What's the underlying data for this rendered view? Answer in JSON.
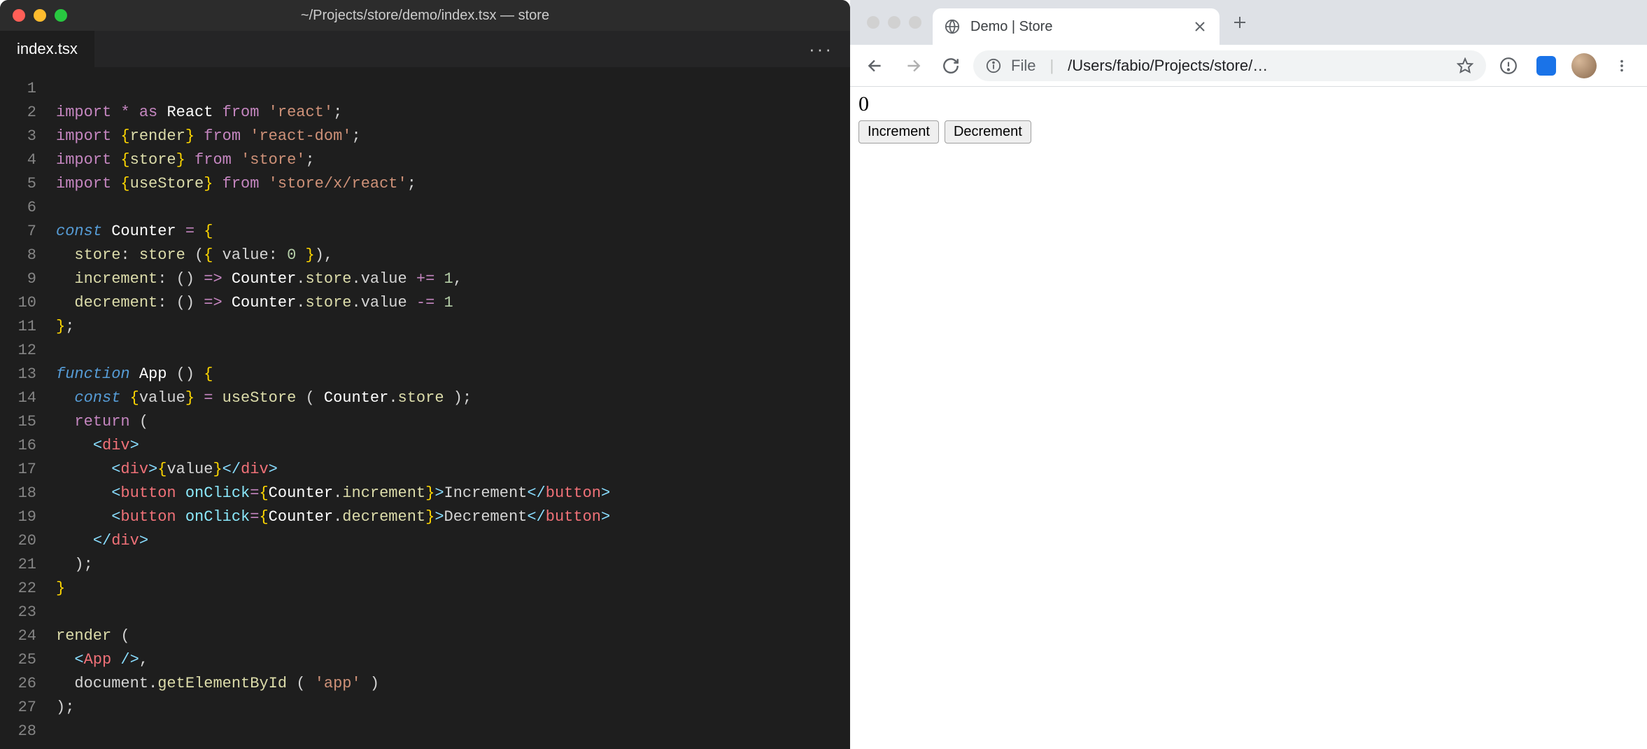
{
  "editor": {
    "window_title": "~/Projects/store/demo/index.tsx — store",
    "tab": {
      "label": "index.tsx"
    },
    "more_label": "···",
    "code_lines": [
      "",
      "import * as React from 'react';",
      "import {render} from 'react-dom';",
      "import {store} from 'store';",
      "import {useStore} from 'store/x/react';",
      "",
      "const Counter = {",
      "  store: store ({ value: 0 }),",
      "  increment: () => Counter.store.value += 1,",
      "  decrement: () => Counter.store.value -= 1",
      "};",
      "",
      "function App () {",
      "  const {value} = useStore ( Counter.store );",
      "  return (",
      "    <div>",
      "      <div>{value}</div>",
      "      <button onClick={Counter.increment}>Increment</button>",
      "      <button onClick={Counter.decrement}>Decrement</button>",
      "    </div>",
      "  );",
      "}",
      "",
      "render (",
      "  <App />,",
      "  document.getElementById ( 'app' )",
      ");",
      ""
    ]
  },
  "browser": {
    "tab_title": "Demo | Store",
    "url_scheme": "File",
    "url_path": "/Users/fabio/Projects/store/…",
    "page": {
      "counter_value": "0",
      "increment_label": "Increment",
      "decrement_label": "Decrement"
    }
  }
}
